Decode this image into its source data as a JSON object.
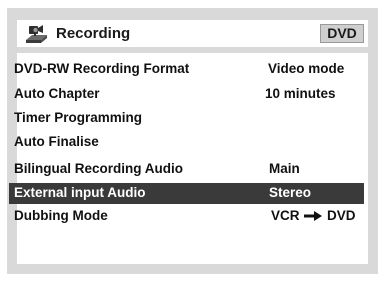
{
  "header": {
    "title": "Recording",
    "icon": "recorder-icon",
    "badge": "DVD"
  },
  "menu": {
    "items": [
      {
        "label": "DVD-RW Recording Format",
        "value": "Video mode",
        "selected": false
      },
      {
        "label": "Auto Chapter",
        "value": "10 minutes",
        "selected": false
      },
      {
        "label": "Timer Programming",
        "value": "",
        "selected": false
      },
      {
        "label": "Auto Finalise",
        "value": "",
        "selected": false
      },
      {
        "label": "Bilingual Recording Audio",
        "value": "Main",
        "selected": false
      },
      {
        "label": "External input Audio",
        "value": "Stereo",
        "selected": true
      },
      {
        "label": "Dubbing Mode",
        "value_from": "VCR",
        "value_to": "DVD",
        "value_icon": "right-arrow-icon",
        "selected": false
      }
    ]
  },
  "colors": {
    "frame": "#d9d9d9",
    "highlight": "#3a3a3a",
    "text": "#111111"
  }
}
